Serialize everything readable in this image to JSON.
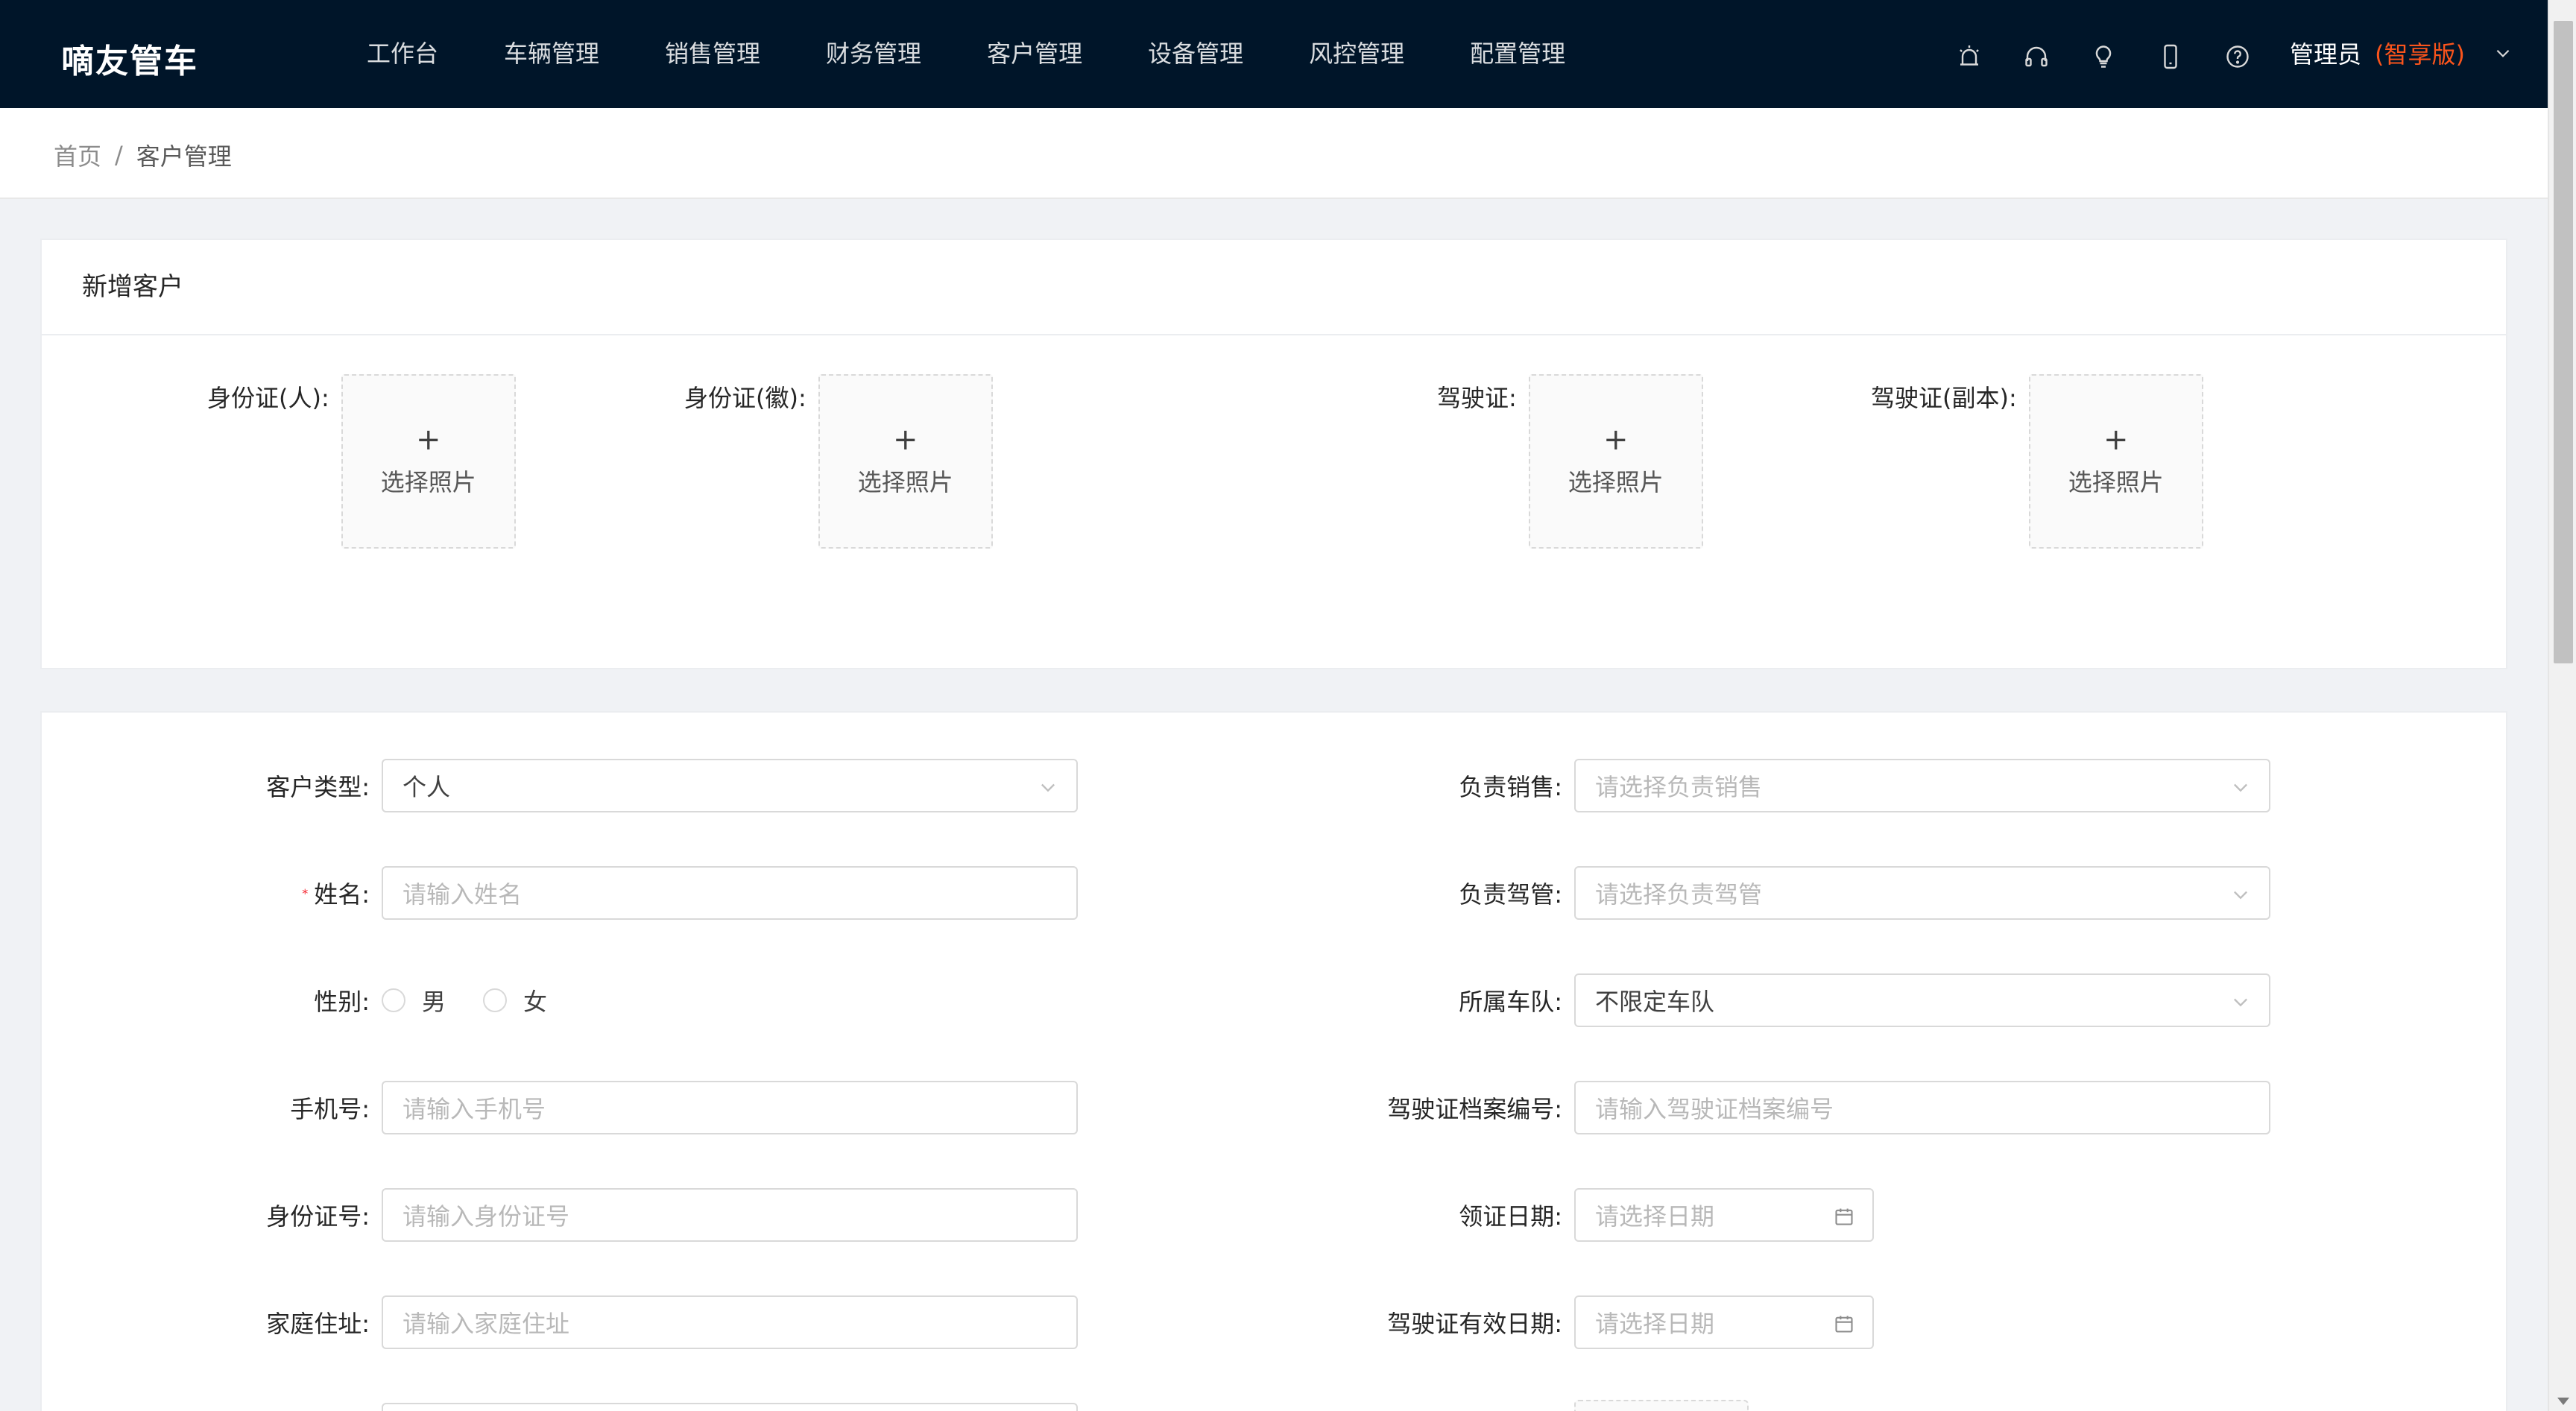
{
  "app": {
    "logo": "嘀友管车"
  },
  "nav": {
    "items": [
      "工作台",
      "车辆管理",
      "销售管理",
      "财务管理",
      "客户管理",
      "设备管理",
      "风控管理",
      "配置管理"
    ],
    "icons": [
      "alarm-icon",
      "headset-icon",
      "bulb-icon",
      "mobile-icon",
      "help-icon"
    ],
    "user": {
      "name": "管理员",
      "edition": "(智享版)"
    }
  },
  "breadcrumb": {
    "home": "首页",
    "separator": "/",
    "current": "客户管理"
  },
  "card_upload": {
    "title": "新增客户",
    "upload_text": "选择照片",
    "plus": "+",
    "fields": [
      "身份证(人):",
      "身份证(徽):",
      "驾驶证:",
      "驾驶证(副本):"
    ]
  },
  "form": {
    "customer_type": {
      "label": "客户类型:",
      "value": "个人"
    },
    "name": {
      "label": "姓名:",
      "placeholder": "请输入姓名",
      "required_mark": "*"
    },
    "gender": {
      "label": "性别:",
      "options": [
        "男",
        "女"
      ]
    },
    "phone": {
      "label": "手机号:",
      "placeholder": "请输入手机号"
    },
    "id_number": {
      "label": "身份证号:",
      "placeholder": "请输入身份证号"
    },
    "address": {
      "label": "家庭住址:",
      "placeholder": "请输入家庭住址"
    },
    "sales": {
      "label": "负责销售:",
      "placeholder": "请选择负责销售"
    },
    "driver_manager": {
      "label": "负责驾管:",
      "placeholder": "请选择负责驾管"
    },
    "fleet": {
      "label": "所属车队:",
      "value": "不限定车队"
    },
    "license_archive": {
      "label": "驾驶证档案编号:",
      "placeholder": "请输入驾驶证档案编号"
    },
    "license_issue_date": {
      "label": "领证日期:",
      "placeholder": "请选择日期"
    },
    "license_valid_date": {
      "label": "驾驶证有效日期:",
      "placeholder": "请选择日期"
    }
  },
  "colors": {
    "nav_bg": "#001529",
    "edition": "#fa541c",
    "required": "#f5222d",
    "page_bg": "#f0f2f5"
  }
}
